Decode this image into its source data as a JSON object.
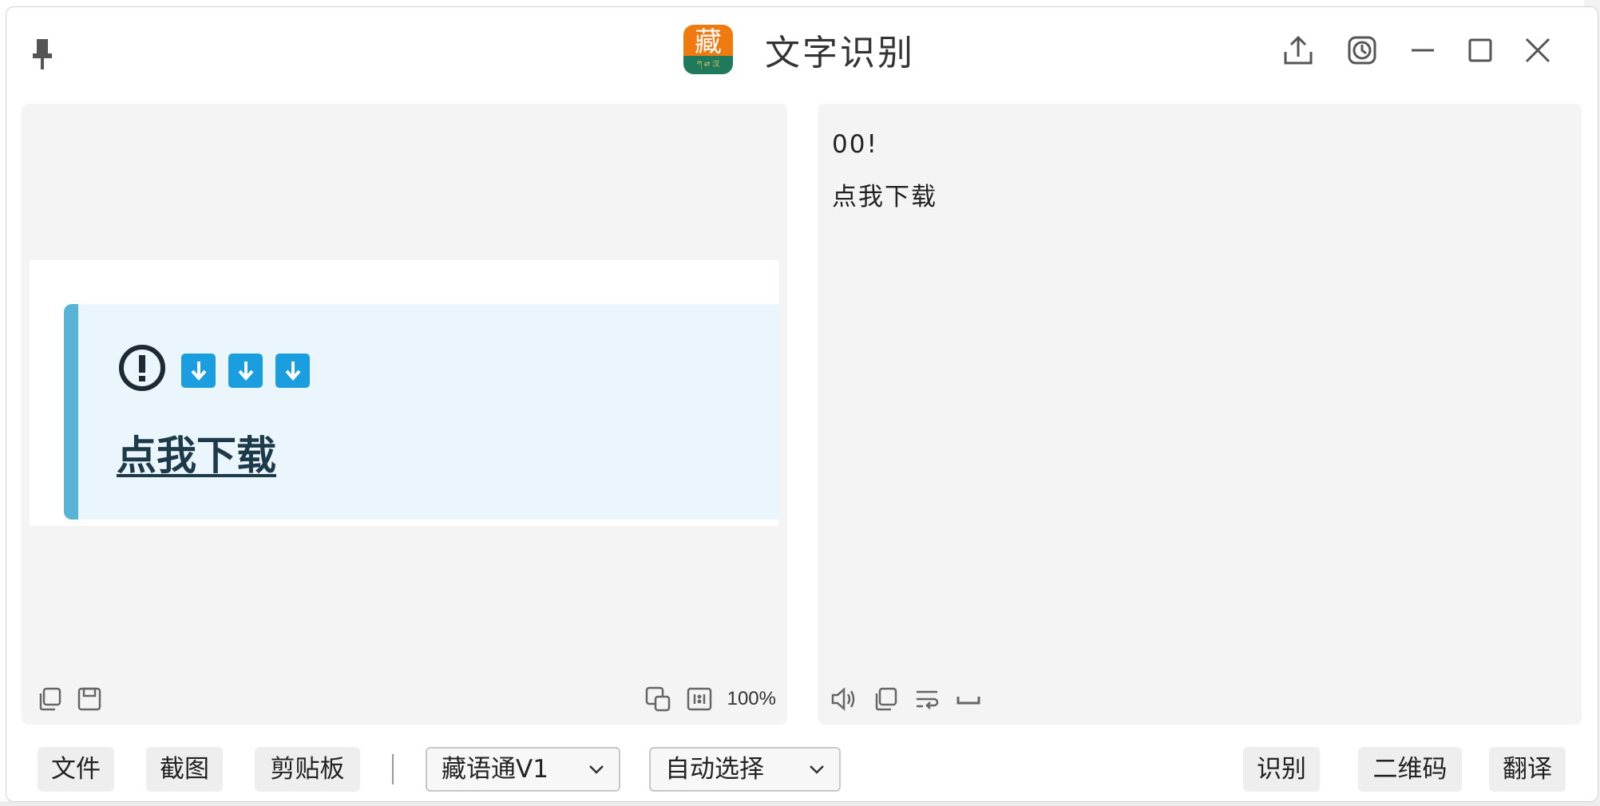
{
  "window": {
    "title": "文字识别",
    "logo_char": "藏",
    "logo_sub": "ཀ ⇄ 汉"
  },
  "titlebar_icons": [
    "pin-icon",
    "share-upload-icon",
    "history-clock-icon",
    "minimize-icon",
    "maximize-icon",
    "close-icon"
  ],
  "left_panel": {
    "preview": {
      "link_text": "点我下载",
      "buttons": [
        "download-arrow",
        "download-arrow",
        "download-arrow"
      ]
    },
    "zoom": "100%",
    "tools_left": [
      "copy-icon",
      "save-icon"
    ],
    "tools_right": [
      "overlay-icon",
      "actual-size-icon"
    ]
  },
  "right_panel": {
    "lines": [
      "00!",
      "点我下载"
    ],
    "tools": [
      "speaker-icon",
      "copy-icon",
      "wrap-icon",
      "space-icon"
    ]
  },
  "bottombar": {
    "file_label": "文件",
    "screenshot_label": "截图",
    "clipboard_label": "剪贴板",
    "engine_select": "藏语通V1",
    "language_select": "自动选择",
    "recognize_label": "识别",
    "qrcode_label": "二维码",
    "translate_label": "翻译"
  },
  "colors": {
    "accent_blue": "#1a9ee0",
    "notice_border": "#58b3d4",
    "logo_orange": "#f07a10",
    "logo_green": "#1e7a5a"
  }
}
